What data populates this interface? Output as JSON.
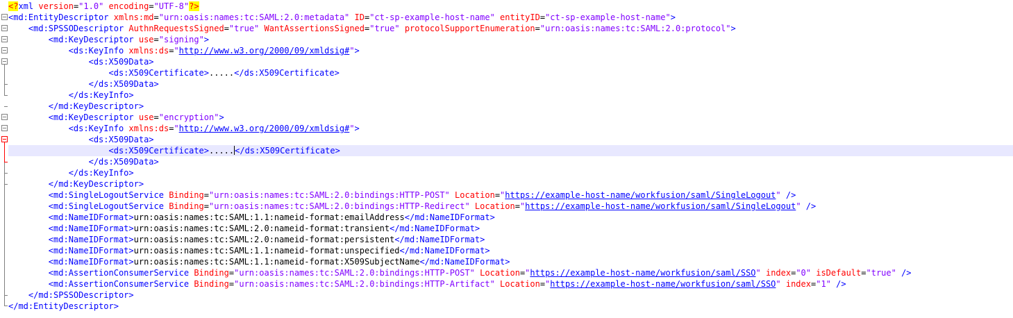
{
  "editor": {
    "language": "xml",
    "current_line_index": 13,
    "caret_line_index": 13,
    "lines": [
      [
        [
          "pi",
          "<?"
        ],
        [
          "tag",
          "xml "
        ],
        [
          "attr",
          "version"
        ],
        [
          "eq",
          "="
        ],
        [
          "str",
          "\"1.0\" "
        ],
        [
          "attr",
          "encoding"
        ],
        [
          "eq",
          "="
        ],
        [
          "str",
          "\"UTF-8\""
        ],
        [
          "pi",
          "?>"
        ]
      ],
      [
        [
          "tag",
          "<md:EntityDescriptor "
        ],
        [
          "attr",
          "xmlns:md"
        ],
        [
          "eq",
          "="
        ],
        [
          "str",
          "\"urn:oasis:names:tc:SAML:2.0:metadata\" "
        ],
        [
          "attr",
          "ID"
        ],
        [
          "eq",
          "="
        ],
        [
          "str",
          "\"ct-sp-example-host-name\" "
        ],
        [
          "attr",
          "entityID"
        ],
        [
          "eq",
          "="
        ],
        [
          "str",
          "\"ct-sp-example-host-name\""
        ],
        [
          "tag",
          ">"
        ]
      ],
      [
        [
          "ws",
          "    "
        ],
        [
          "tag",
          "<md:SPSSODescriptor "
        ],
        [
          "attr",
          "AuthnRequestsSigned"
        ],
        [
          "eq",
          "="
        ],
        [
          "str",
          "\"true\" "
        ],
        [
          "attr",
          "WantAssertionsSigned"
        ],
        [
          "eq",
          "="
        ],
        [
          "str",
          "\"true\" "
        ],
        [
          "attr",
          "protocolSupportEnumeration"
        ],
        [
          "eq",
          "="
        ],
        [
          "str",
          "\"urn:oasis:names:tc:SAML:2.0:protocol\""
        ],
        [
          "tag",
          ">"
        ]
      ],
      [
        [
          "ws",
          "        "
        ],
        [
          "tag",
          "<md:KeyDescriptor "
        ],
        [
          "attr",
          "use"
        ],
        [
          "eq",
          "="
        ],
        [
          "str",
          "\"signing\""
        ],
        [
          "tag",
          ">"
        ]
      ],
      [
        [
          "ws",
          "            "
        ],
        [
          "tag",
          "<ds:KeyInfo "
        ],
        [
          "attr",
          "xmlns:ds"
        ],
        [
          "eq",
          "="
        ],
        [
          "str",
          "\""
        ],
        [
          "url",
          "http://www.w3.org/2000/09/xmldsig#"
        ],
        [
          "str",
          "\""
        ],
        [
          "tag",
          ">"
        ]
      ],
      [
        [
          "ws",
          "                "
        ],
        [
          "tag",
          "<ds:X509Data>"
        ]
      ],
      [
        [
          "ws",
          "                    "
        ],
        [
          "tag",
          "<ds:X509Certificate>"
        ],
        [
          "txt",
          "....."
        ],
        [
          "tag",
          "</ds:X509Certificate>"
        ]
      ],
      [
        [
          "ws",
          "                "
        ],
        [
          "tag",
          "</ds:X509Data>"
        ]
      ],
      [
        [
          "ws",
          "            "
        ],
        [
          "tag",
          "</ds:KeyInfo>"
        ]
      ],
      [
        [
          "ws",
          "        "
        ],
        [
          "tag",
          "</md:KeyDescriptor>"
        ]
      ],
      [
        [
          "ws",
          "        "
        ],
        [
          "tag",
          "<md:KeyDescriptor "
        ],
        [
          "attr",
          "use"
        ],
        [
          "eq",
          "="
        ],
        [
          "str",
          "\"encryption\""
        ],
        [
          "tag",
          ">"
        ]
      ],
      [
        [
          "ws",
          "            "
        ],
        [
          "tag",
          "<ds:KeyInfo "
        ],
        [
          "attr",
          "xmlns:ds"
        ],
        [
          "eq",
          "="
        ],
        [
          "str",
          "\""
        ],
        [
          "url",
          "http://www.w3.org/2000/09/xmldsig#"
        ],
        [
          "str",
          "\""
        ],
        [
          "tag",
          ">"
        ]
      ],
      [
        [
          "ws",
          "                "
        ],
        [
          "tag",
          "<ds:X509Data>"
        ]
      ],
      [
        [
          "ws",
          "                    "
        ],
        [
          "tag",
          "<ds:X509Certificate>"
        ],
        [
          "txt",
          "....."
        ],
        [
          "caret",
          ""
        ],
        [
          "tag",
          "</ds:X509Certificate>"
        ]
      ],
      [
        [
          "ws",
          "                "
        ],
        [
          "tag",
          "</ds:X509Data>"
        ]
      ],
      [
        [
          "ws",
          "            "
        ],
        [
          "tag",
          "</ds:KeyInfo>"
        ]
      ],
      [
        [
          "ws",
          "        "
        ],
        [
          "tag",
          "</md:KeyDescriptor>"
        ]
      ],
      [
        [
          "ws",
          "        "
        ],
        [
          "tag",
          "<md:SingleLogoutService "
        ],
        [
          "attr",
          "Binding"
        ],
        [
          "eq",
          "="
        ],
        [
          "str",
          "\"urn:oasis:names:tc:SAML:2.0:bindings:HTTP-POST\" "
        ],
        [
          "attr",
          "Location"
        ],
        [
          "eq",
          "="
        ],
        [
          "str",
          "\""
        ],
        [
          "url",
          "https://example-host-name/workfusion/saml/SingleLogout"
        ],
        [
          "str",
          "\" "
        ],
        [
          "tag",
          "/>"
        ]
      ],
      [
        [
          "ws",
          "        "
        ],
        [
          "tag",
          "<md:SingleLogoutService "
        ],
        [
          "attr",
          "Binding"
        ],
        [
          "eq",
          "="
        ],
        [
          "str",
          "\"urn:oasis:names:tc:SAML:2.0:bindings:HTTP-Redirect\" "
        ],
        [
          "attr",
          "Location"
        ],
        [
          "eq",
          "="
        ],
        [
          "str",
          "\""
        ],
        [
          "url",
          "https://example-host-name/workfusion/saml/SingleLogout"
        ],
        [
          "str",
          "\" "
        ],
        [
          "tag",
          "/>"
        ]
      ],
      [
        [
          "ws",
          "        "
        ],
        [
          "tag",
          "<md:NameIDFormat>"
        ],
        [
          "txt",
          "urn:oasis:names:tc:SAML:1.1:nameid-format:emailAddress"
        ],
        [
          "tag",
          "</md:NameIDFormat>"
        ]
      ],
      [
        [
          "ws",
          "        "
        ],
        [
          "tag",
          "<md:NameIDFormat>"
        ],
        [
          "txt",
          "urn:oasis:names:tc:SAML:2.0:nameid-format:transient"
        ],
        [
          "tag",
          "</md:NameIDFormat>"
        ]
      ],
      [
        [
          "ws",
          "        "
        ],
        [
          "tag",
          "<md:NameIDFormat>"
        ],
        [
          "txt",
          "urn:oasis:names:tc:SAML:2.0:nameid-format:persistent"
        ],
        [
          "tag",
          "</md:NameIDFormat>"
        ]
      ],
      [
        [
          "ws",
          "        "
        ],
        [
          "tag",
          "<md:NameIDFormat>"
        ],
        [
          "txt",
          "urn:oasis:names:tc:SAML:1.1:nameid-format:unspecified"
        ],
        [
          "tag",
          "</md:NameIDFormat>"
        ]
      ],
      [
        [
          "ws",
          "        "
        ],
        [
          "tag",
          "<md:NameIDFormat>"
        ],
        [
          "txt",
          "urn:oasis:names:tc:SAML:1.1:nameid-format:X509SubjectName"
        ],
        [
          "tag",
          "</md:NameIDFormat>"
        ]
      ],
      [
        [
          "ws",
          "        "
        ],
        [
          "tag",
          "<md:AssertionConsumerService "
        ],
        [
          "attr",
          "Binding"
        ],
        [
          "eq",
          "="
        ],
        [
          "str",
          "\"urn:oasis:names:tc:SAML:2.0:bindings:HTTP-POST\" "
        ],
        [
          "attr",
          "Location"
        ],
        [
          "eq",
          "="
        ],
        [
          "str",
          "\""
        ],
        [
          "url",
          "https://example-host-name/workfusion/saml/SSO"
        ],
        [
          "str",
          "\" "
        ],
        [
          "attr",
          "index"
        ],
        [
          "eq",
          "="
        ],
        [
          "str",
          "\"0\" "
        ],
        [
          "attr",
          "isDefault"
        ],
        [
          "eq",
          "="
        ],
        [
          "str",
          "\"true\" "
        ],
        [
          "tag",
          "/>"
        ]
      ],
      [
        [
          "ws",
          "        "
        ],
        [
          "tag",
          "<md:AssertionConsumerService "
        ],
        [
          "attr",
          "Binding"
        ],
        [
          "eq",
          "="
        ],
        [
          "str",
          "\"urn:oasis:names:tc:SAML:2.0:bindings:HTTP-Artifact\" "
        ],
        [
          "attr",
          "Location"
        ],
        [
          "eq",
          "="
        ],
        [
          "str",
          "\""
        ],
        [
          "url",
          "https://example-host-name/workfusion/saml/SSO"
        ],
        [
          "str",
          "\" "
        ],
        [
          "attr",
          "index"
        ],
        [
          "eq",
          "="
        ],
        [
          "str",
          "\"1\" "
        ],
        [
          "tag",
          "/>"
        ]
      ],
      [
        [
          "ws",
          "    "
        ],
        [
          "tag",
          "</md:SPSSODescriptor>"
        ]
      ],
      [
        [
          "tag",
          "</md:EntityDescriptor>"
        ]
      ]
    ]
  }
}
